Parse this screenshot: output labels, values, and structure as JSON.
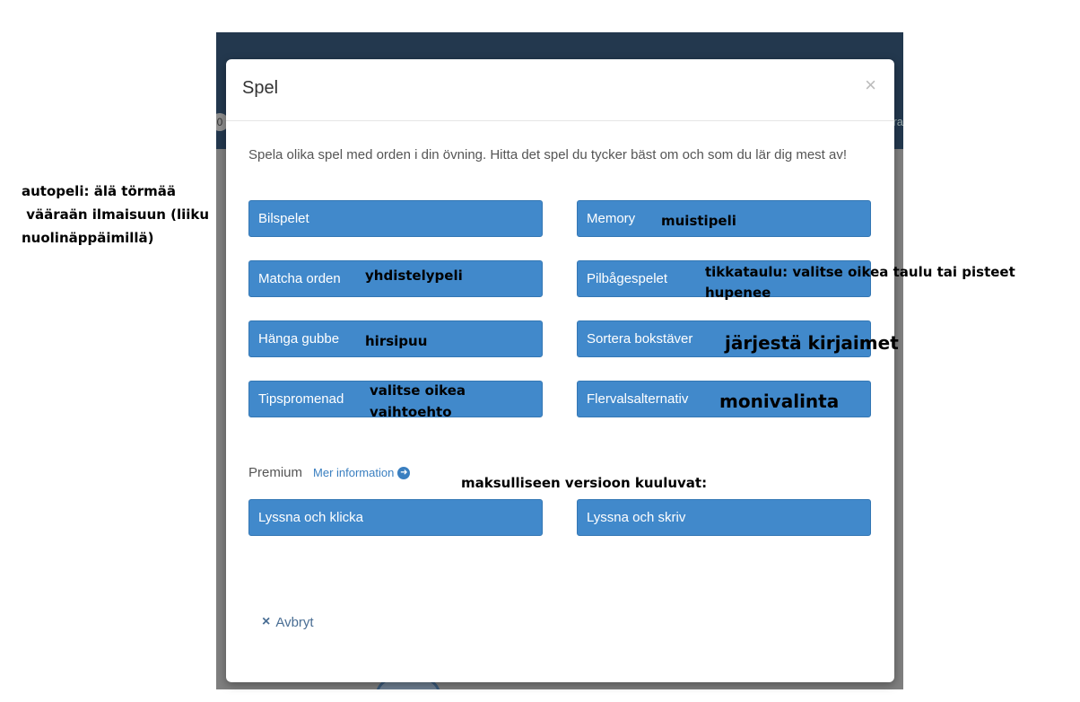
{
  "modal": {
    "title": "Spel",
    "close_symbol": "×",
    "intro": "Spela olika spel med orden i din övning. Hitta det spel du tycker bäst om och som du lär dig mest av!",
    "games": [
      {
        "label": "Bilspelet"
      },
      {
        "label": "Memory"
      },
      {
        "label": "Matcha orden"
      },
      {
        "label": "Pilbågespelet"
      },
      {
        "label": "Hänga gubbe"
      },
      {
        "label": "Sortera bokstäver"
      },
      {
        "label": "Tipspromenad"
      },
      {
        "label": "Flervalsalternativ"
      }
    ],
    "premium_label": "Premium",
    "premium_link": "Mer information",
    "premium_games": [
      {
        "label": "Lyssna och klicka"
      },
      {
        "label": "Lyssna och skriv"
      }
    ],
    "cancel_label": "Avbryt",
    "cancel_icon": "×"
  },
  "background": {
    "left_fragment": "0",
    "right_fragment": "ra"
  },
  "annotations": {
    "autopeli_line1": "autopeli: älä törmää",
    "autopeli_line2": " vääraän ilmaisuun (liiku",
    "autopeli_line3": "nuolinäppäimillä)",
    "memory": "muistipeli",
    "matcha": "yhdistelypeli",
    "pilbage_line1": "tikkataulu: valitse oikea taulu tai pisteet",
    "pilbage_line2": "hupenee",
    "hanga": "hirsipuu",
    "sortera": "järjestä kirjaimet",
    "tips_line1": "valitse oikea",
    "tips_line2": "vaihtoehto",
    "flerval": "monivalinta",
    "premium": "maksulliseen versioon kuuluvat:"
  },
  "colors": {
    "button": "#4189cb",
    "header_bar": "#23384e",
    "link": "#3a7fc0"
  },
  "icons": {
    "close": "close-icon",
    "arrow": "arrow-right-circle-icon",
    "cancel": "x-icon"
  }
}
